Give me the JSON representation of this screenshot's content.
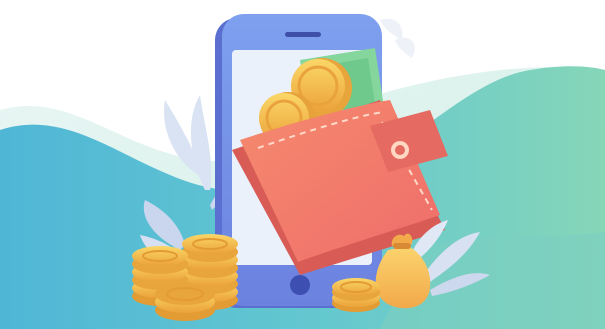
{
  "illustration": {
    "subject": "mobile-wallet",
    "elements": [
      "smartphone",
      "wallet",
      "gold-coins",
      "banknote",
      "money-bag",
      "leaves",
      "wave-background"
    ]
  },
  "colors": {
    "background": "#ffffff",
    "wave_light": "#e7f2f1",
    "wave_teal": "#7fd1c2",
    "wave_blue": "#62c3d9",
    "phone_body": "#6f8fe3",
    "phone_side": "#5a6fd0",
    "phone_screen": "#e9f1fb",
    "wallet": "#f07a68",
    "wallet_dark": "#d85b56",
    "coin": "#f6c44c",
    "coin_dark": "#e7a33a",
    "note": "#7fd29b",
    "bag": "#f7c35c",
    "leaf": "#cdd9ef"
  }
}
